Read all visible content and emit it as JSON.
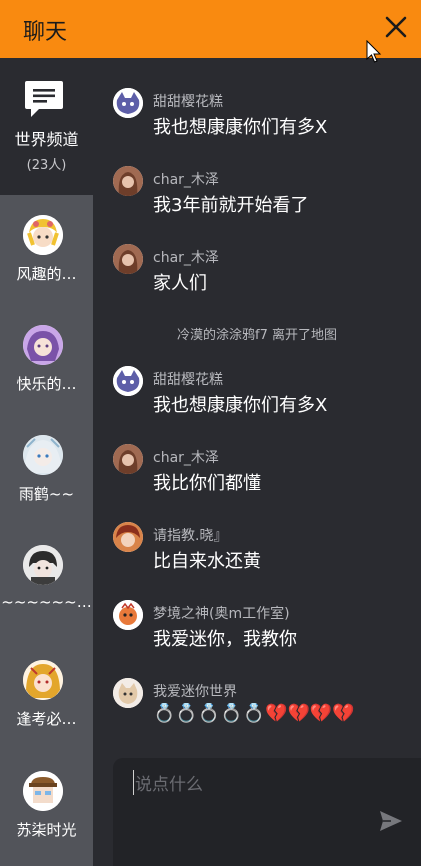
{
  "header": {
    "title": "聊天"
  },
  "sidebar": {
    "world": {
      "label": "世界频道",
      "count": "(23人)"
    },
    "contacts": [
      {
        "name": "风趣的…"
      },
      {
        "name": "快乐的…"
      },
      {
        "name": "雨鹤~~"
      },
      {
        "name": "~~~~~~…"
      },
      {
        "name": "逢考必…"
      },
      {
        "name": "苏柒时光"
      }
    ]
  },
  "messages": [
    {
      "sender": "甜甜樱花糕",
      "text": "我也想康康你们有多X"
    },
    {
      "sender": "char_木泽",
      "text": "我3年前就开始看了"
    },
    {
      "sender": "char_木泽",
      "text": "家人们"
    },
    {
      "sender": "甜甜樱花糕",
      "text": "我也想康康你们有多X"
    },
    {
      "sender": "char_木泽",
      "text": "我比你们都懂"
    },
    {
      "sender": "请指教.晓』",
      "text": "比自来水还黄"
    },
    {
      "sender": "梦境之神(奥m工作室)",
      "text": "我爱迷你，我教你"
    },
    {
      "sender": "我爱迷你世界",
      "text": "💍💍💍💍💍💔💔💔💔"
    }
  ],
  "system_note": "冷漠的涂涂鸦f7 离开了地图",
  "composer": {
    "placeholder": "说点什么"
  },
  "colors": {
    "header": "#f98a10",
    "background": "#2a2b30",
    "sidebar_contacts": "#52545a"
  }
}
